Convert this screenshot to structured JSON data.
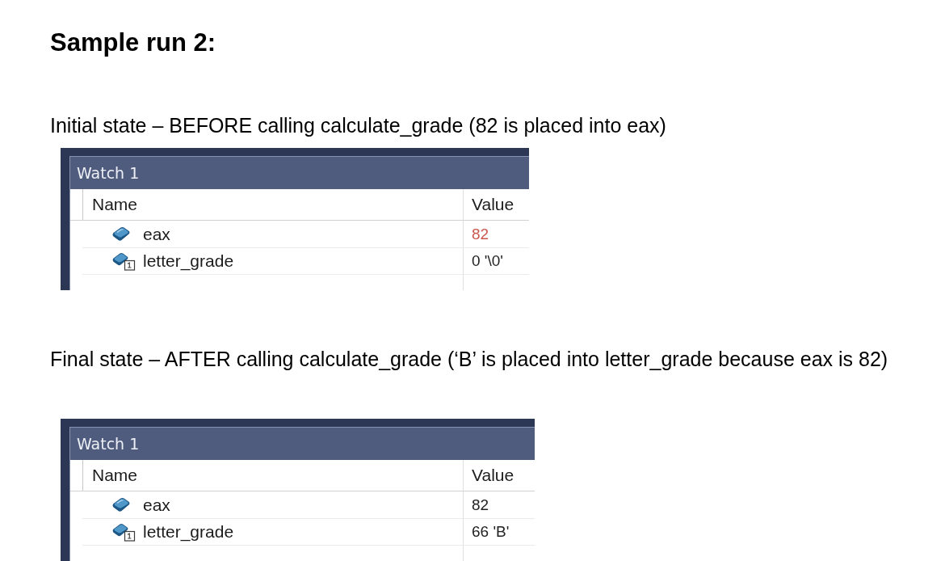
{
  "heading": "Sample run 2:",
  "sections": [
    {
      "caption": "Initial state – BEFORE calling calculate_grade (82 is placed into eax)",
      "watch": {
        "title": "Watch 1",
        "columns": [
          "Name",
          "Value"
        ],
        "rows": [
          {
            "kind": "register",
            "name": "eax",
            "value": "82",
            "changed": true
          },
          {
            "kind": "variable",
            "name": "letter_grade",
            "value": "0 '\\0'",
            "changed": false
          }
        ]
      }
    },
    {
      "caption": "Final state – AFTER calling calculate_grade (‘B’ is placed into letter_grade because eax is 82)",
      "watch": {
        "title": "Watch 1",
        "columns": [
          "Name",
          "Value"
        ],
        "rows": [
          {
            "kind": "register",
            "name": "eax",
            "value": "82",
            "changed": false
          },
          {
            "kind": "variable",
            "name": "letter_grade",
            "value": "66 'B'",
            "changed": false
          }
        ]
      }
    }
  ]
}
